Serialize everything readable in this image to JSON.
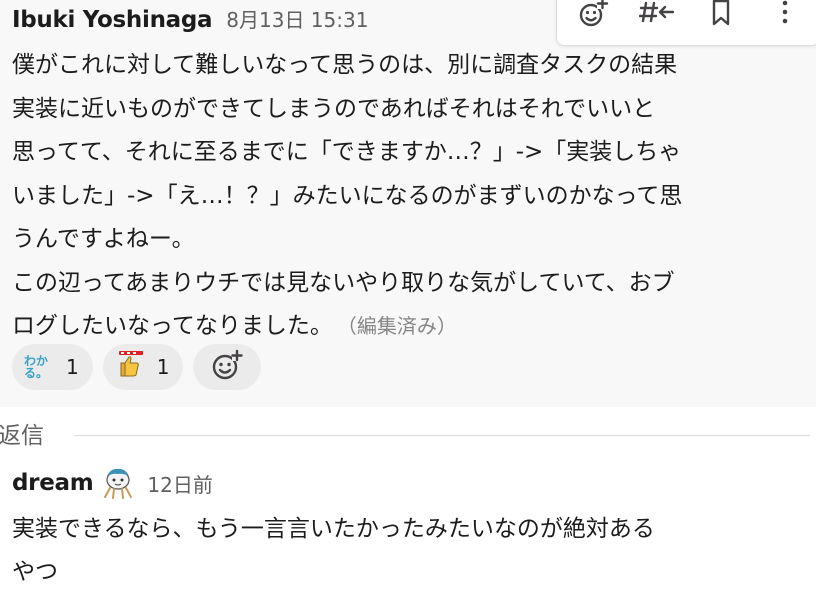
{
  "message": {
    "author": "Ibuki Yoshinaga",
    "timestamp": "8月13日 15:31",
    "lines": [
      "僕がこれに対して難しいなって思うのは、別に調査タスクの結果",
      "実装に近いものができてしまうのであればそれはそれでいいと",
      "思ってて、それに至るまでに「できますか…？」->「実装しちゃ",
      "いました」->「え…！？」みたいになるのがまずいのかなって思",
      "うんですよねー。",
      "この辺ってあまりウチでは見ないやり取りな気がしていて、おブ",
      "ログしたいなってなりました。"
    ],
    "edited_label": "（編集済み）"
  },
  "actions": {
    "icons": [
      "add-reaction-icon",
      "reply-thread-icon",
      "bookmark-icon",
      "more-vertical-icon"
    ]
  },
  "reactions": [
    {
      "emoji_text": "わかる。",
      "count": "1"
    },
    {
      "emoji_icon": "thumbs-up-good-icon",
      "count": "1"
    }
  ],
  "replies": {
    "label": "返信"
  },
  "reply": {
    "author": "dream",
    "timestamp": "12日前",
    "lines": [
      "実装できるなら、もう一言言いたかったみたいなのが絶対ある",
      "やつ"
    ]
  },
  "colors": {
    "message_bg": "#f8f8f8",
    "reaction_bg": "#ebebeb",
    "wakaru_text": "#3aa3c7",
    "muted_text": "#616061"
  }
}
